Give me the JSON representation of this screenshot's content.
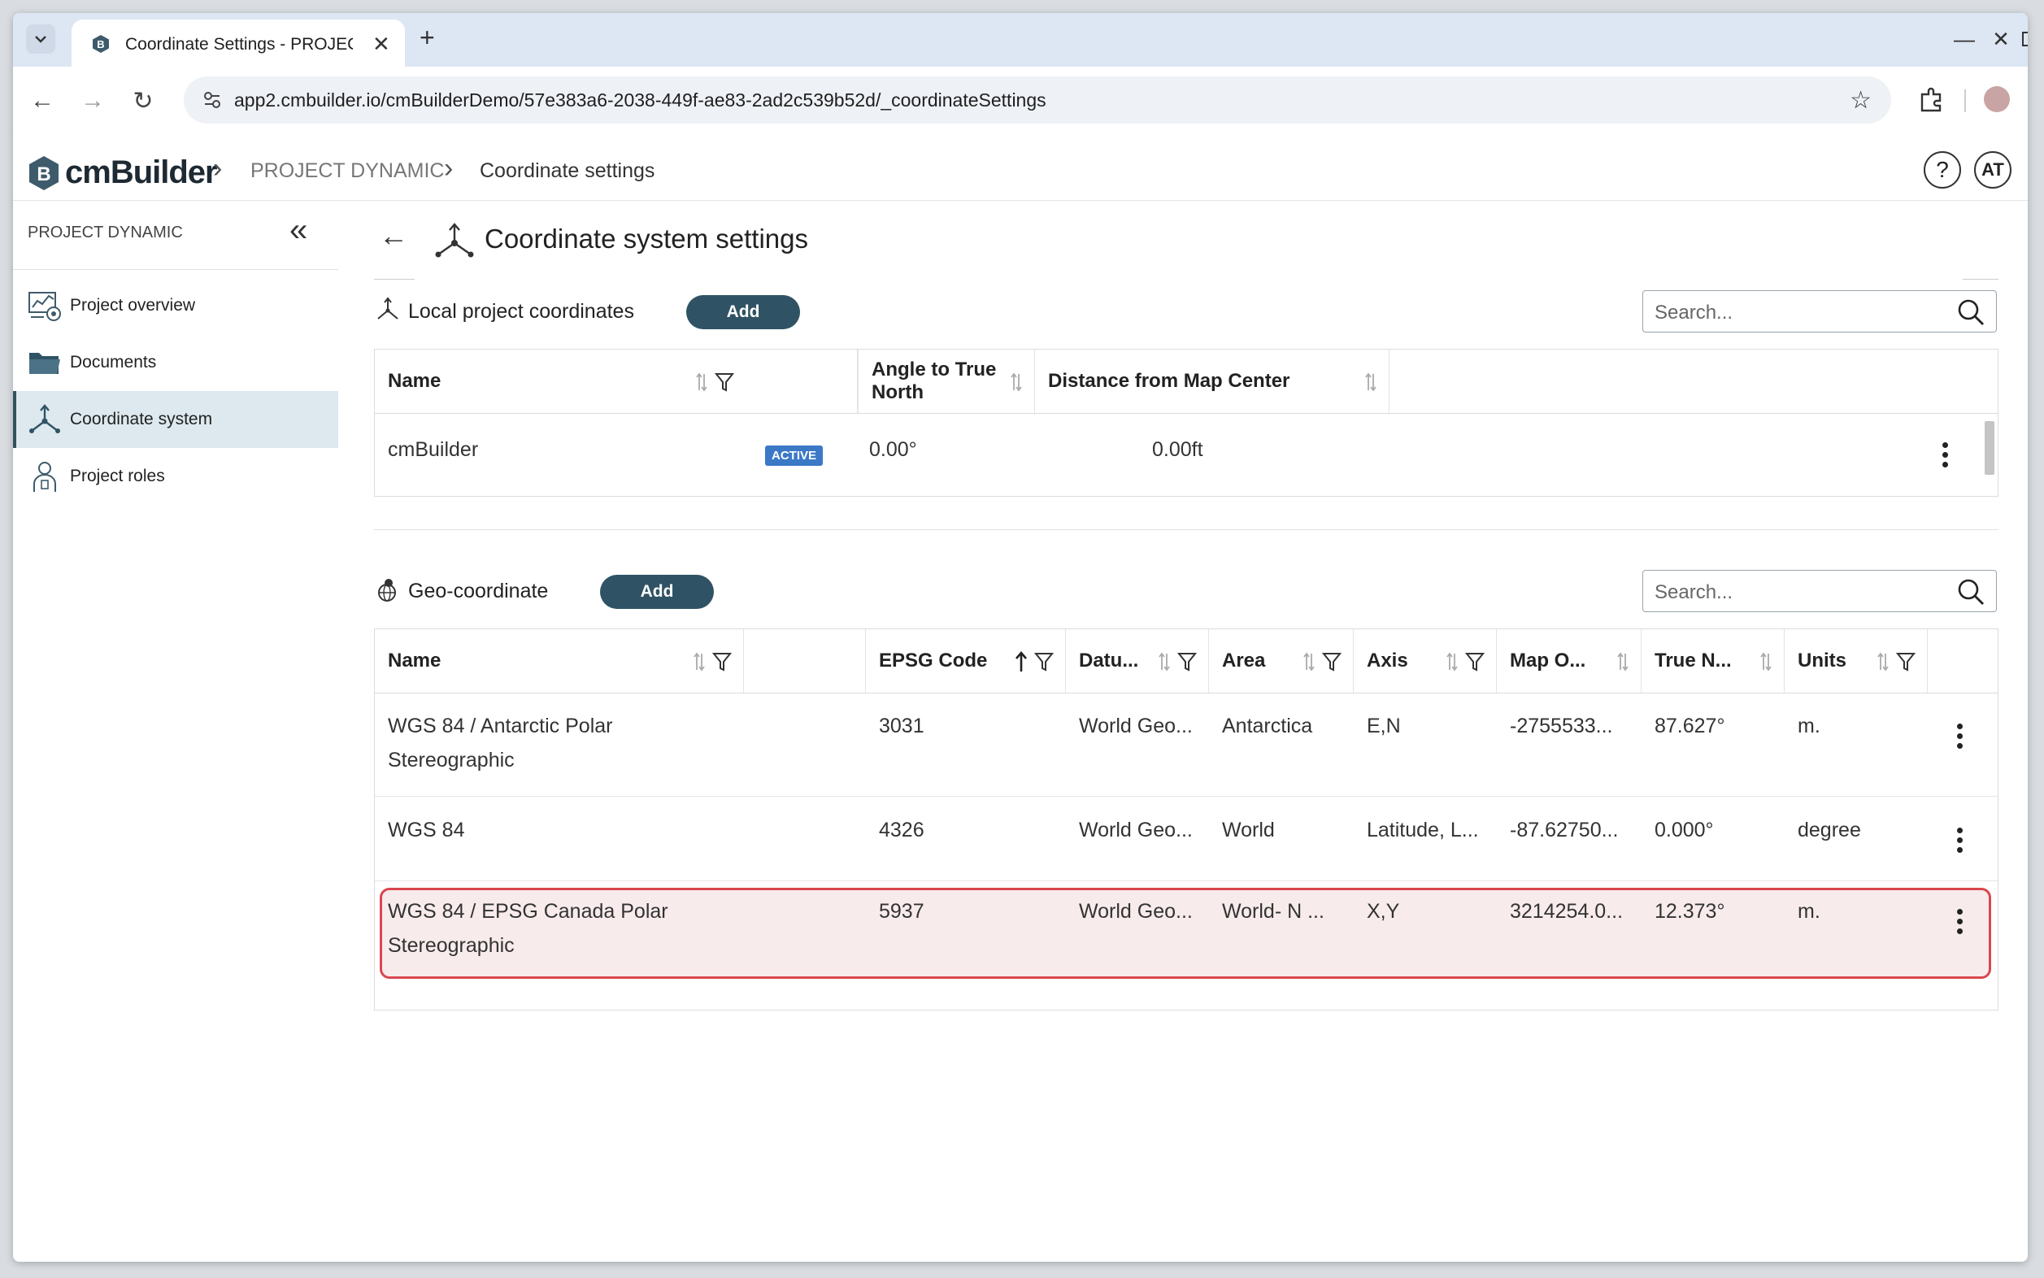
{
  "browser": {
    "tab_title": "Coordinate Settings - PROJECT",
    "url": "app2.cmbuilder.io/cmBuilderDemo/57e383a6-2038-449f-ae83-2ad2c539b52d/_coordinateSettings"
  },
  "header": {
    "logo_text": "cmBuilder",
    "breadcrumb": [
      "PROJECT DYNAMIC",
      "Coordinate settings"
    ],
    "help_label": "?",
    "avatar_initials": "AT"
  },
  "sidebar": {
    "title": "PROJECT DYNAMIC",
    "items": [
      {
        "label": "Project overview",
        "icon": "project-overview-icon"
      },
      {
        "label": "Documents",
        "icon": "folder-icon"
      },
      {
        "label": "Coordinate system",
        "icon": "coordinate-axes-icon",
        "active": true
      },
      {
        "label": "Project roles",
        "icon": "person-icon"
      }
    ]
  },
  "page": {
    "title": "Coordinate system settings"
  },
  "local": {
    "label": "Local project coordinates",
    "add_label": "Add",
    "search_placeholder": "Search...",
    "columns": [
      "Name",
      "Angle to True North",
      "Distance from Map Center"
    ],
    "rows": [
      {
        "name": "cmBuilder",
        "status": "ACTIVE",
        "angle": "0.00°",
        "distance": "0.00ft"
      }
    ]
  },
  "geo": {
    "label": "Geo-coordinate",
    "add_label": "Add",
    "search_placeholder": "Search...",
    "columns": [
      "Name",
      "EPSG Code",
      "Datu...",
      "Area",
      "Axis",
      "Map O...",
      "True N...",
      "Units"
    ],
    "rows": [
      {
        "name": "WGS 84 / Antarctic Polar Stereographic",
        "epsg": "3031",
        "datum": "World Geo...",
        "area": "Antarctica",
        "axis": "E,N",
        "map_origin": "-2755533...",
        "true_north": "87.627°",
        "units": "m."
      },
      {
        "name": "WGS 84",
        "epsg": "4326",
        "datum": "World Geo...",
        "area": "World",
        "axis": "Latitude, L...",
        "map_origin": "-87.62750...",
        "true_north": "0.000°",
        "units": "degree"
      },
      {
        "name": "WGS 84 / EPSG Canada Polar Stereographic",
        "epsg": "5937",
        "datum": "World Geo...",
        "area": "World- N ...",
        "axis": "X,Y",
        "map_origin": "3214254.0...",
        "true_north": "12.373°",
        "units": "m.",
        "highlighted": true
      }
    ]
  },
  "colors": {
    "accent": "#2f5364",
    "active_badge": "#3b79c7",
    "highlight_border": "#d9474f",
    "sidebar_active_bg": "#dde9ef"
  }
}
